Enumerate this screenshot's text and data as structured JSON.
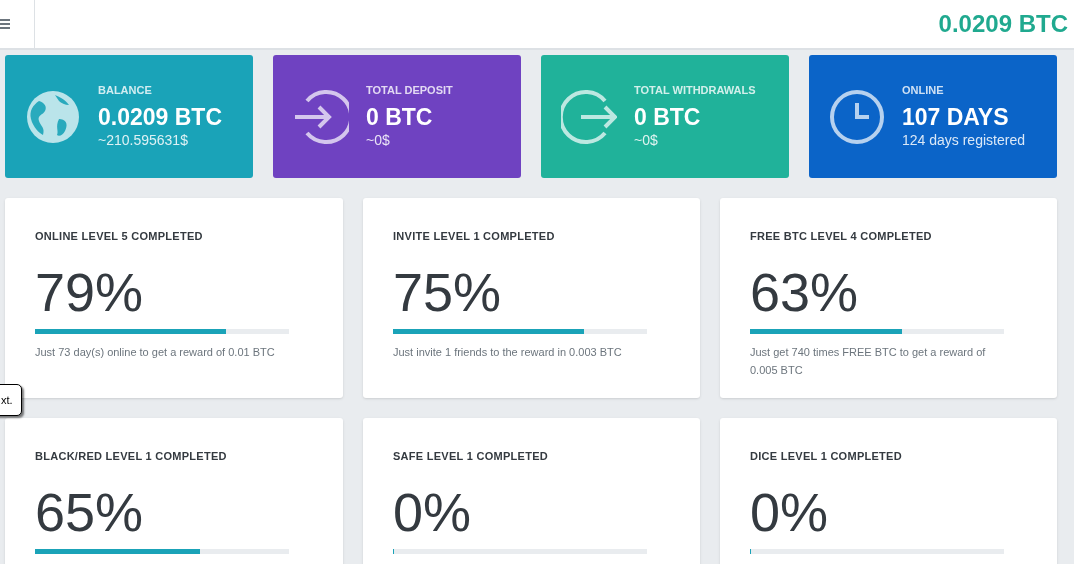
{
  "header": {
    "balance": "0.0209 BTC"
  },
  "stats": [
    {
      "kind": "globe",
      "color": "#1aa3b8",
      "label": "BALANCE",
      "value": "0.0209 BTC",
      "sub": "~210.595631$"
    },
    {
      "kind": "enter",
      "color": "#6f42c1",
      "label": "TOTAL DEPOSIT",
      "value": "0 BTC",
      "sub": "~0$"
    },
    {
      "kind": "exit",
      "color": "#20b29a",
      "label": "TOTAL WITHDRAWALS",
      "value": "0 BTC",
      "sub": "~0$"
    },
    {
      "kind": "clock",
      "color": "#0b64c8",
      "label": "ONLINE",
      "value": "107 DAYS",
      "sub": "124 days registered"
    }
  ],
  "levels": [
    {
      "title": "ONLINE LEVEL 5 COMPLETED",
      "percent": "79%",
      "level": 0.75,
      "description": "Just 73 day(s) online to get a reward of 0.01 BTC"
    },
    {
      "title": "INVITE LEVEL 1 COMPLETED",
      "percent": "75%",
      "level": 0.75,
      "description": "Just invite 1 friends to the reward in 0.003 BTC"
    },
    {
      "title": "FREE BTC LEVEL 4 COMPLETED",
      "percent": "63%",
      "level": 0.6,
      "description": "Just get 740 times FREE BTC to get a reward of 0.005 BTC"
    },
    {
      "title": "BLACK/RED LEVEL 1 COMPLETED",
      "percent": "65%",
      "level": 0.65
    },
    {
      "title": "SAFE LEVEL 1 COMPLETED",
      "percent": "0%",
      "level": 0
    },
    {
      "title": "DICE LEVEL 1 COMPLETED",
      "percent": "0%",
      "level": 0
    }
  ],
  "tooltip": {
    "text": "xt."
  }
}
